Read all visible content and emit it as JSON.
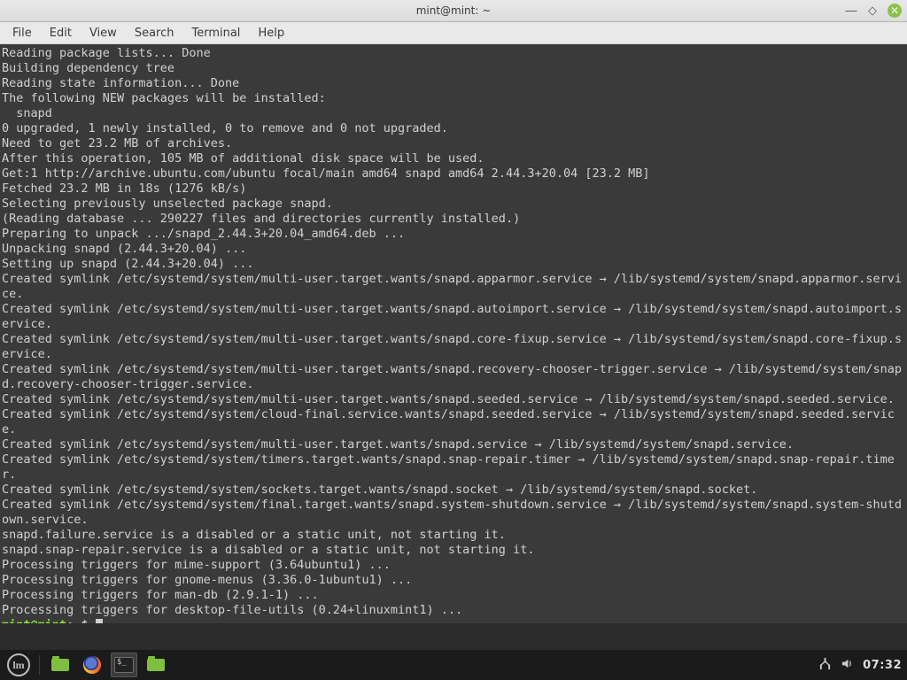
{
  "titlebar": {
    "title": "mint@mint: ~"
  },
  "menubar": [
    "File",
    "Edit",
    "View",
    "Search",
    "Terminal",
    "Help"
  ],
  "terminal": {
    "lines": [
      "Reading package lists... Done",
      "Building dependency tree",
      "Reading state information... Done",
      "The following NEW packages will be installed:",
      "  snapd",
      "0 upgraded, 1 newly installed, 0 to remove and 0 not upgraded.",
      "Need to get 23.2 MB of archives.",
      "After this operation, 105 MB of additional disk space will be used.",
      "Get:1 http://archive.ubuntu.com/ubuntu focal/main amd64 snapd amd64 2.44.3+20.04 [23.2 MB]",
      "Fetched 23.2 MB in 18s (1276 kB/s)",
      "Selecting previously unselected package snapd.",
      "(Reading database ... 290227 files and directories currently installed.)",
      "Preparing to unpack .../snapd_2.44.3+20.04_amd64.deb ...",
      "Unpacking snapd (2.44.3+20.04) ...",
      "Setting up snapd (2.44.3+20.04) ...",
      "Created symlink /etc/systemd/system/multi-user.target.wants/snapd.apparmor.service → /lib/systemd/system/snapd.apparmor.service.",
      "Created symlink /etc/systemd/system/multi-user.target.wants/snapd.autoimport.service → /lib/systemd/system/snapd.autoimport.service.",
      "Created symlink /etc/systemd/system/multi-user.target.wants/snapd.core-fixup.service → /lib/systemd/system/snapd.core-fixup.service.",
      "Created symlink /etc/systemd/system/multi-user.target.wants/snapd.recovery-chooser-trigger.service → /lib/systemd/system/snapd.recovery-chooser-trigger.service.",
      "Created symlink /etc/systemd/system/multi-user.target.wants/snapd.seeded.service → /lib/systemd/system/snapd.seeded.service.",
      "Created symlink /etc/systemd/system/cloud-final.service.wants/snapd.seeded.service → /lib/systemd/system/snapd.seeded.service.",
      "Created symlink /etc/systemd/system/multi-user.target.wants/snapd.service → /lib/systemd/system/snapd.service.",
      "Created symlink /etc/systemd/system/timers.target.wants/snapd.snap-repair.timer → /lib/systemd/system/snapd.snap-repair.timer.",
      "Created symlink /etc/systemd/system/sockets.target.wants/snapd.socket → /lib/systemd/system/snapd.socket.",
      "Created symlink /etc/systemd/system/final.target.wants/snapd.system-shutdown.service → /lib/systemd/system/snapd.system-shutdown.service.",
      "snapd.failure.service is a disabled or a static unit, not starting it.",
      "snapd.snap-repair.service is a disabled or a static unit, not starting it.",
      "Processing triggers for mime-support (3.64ubuntu1) ...",
      "Processing triggers for gnome-menus (3.36.0-1ubuntu1) ...",
      "Processing triggers for man-db (2.9.1-1) ...",
      "Processing triggers for desktop-file-utils (0.24+linuxmint1) ..."
    ],
    "prompt": {
      "user": "mint@mint",
      "path": "~",
      "suffix": "$ "
    }
  },
  "taskbar": {
    "time": "07:32",
    "net_label": "network",
    "sound_label": "sound"
  }
}
